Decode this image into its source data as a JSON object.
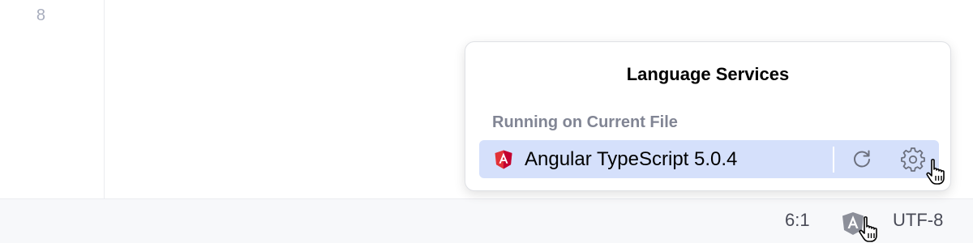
{
  "editor": {
    "line_number": "8"
  },
  "popup": {
    "title": "Language Services",
    "section_header": "Running on Current File",
    "service": {
      "name": "Angular TypeScript 5.0.4",
      "icon": "angular-icon",
      "actions": [
        "restart-icon",
        "settings-icon"
      ]
    }
  },
  "statusbar": {
    "position": "6:1",
    "language_services_icon": "angular-icon",
    "encoding": "UTF-8"
  },
  "colors": {
    "row_highlight": "#d5e0fb",
    "angular_red": "#e23237",
    "angular_magenta": "#c3002f",
    "muted_text": "#818594"
  }
}
